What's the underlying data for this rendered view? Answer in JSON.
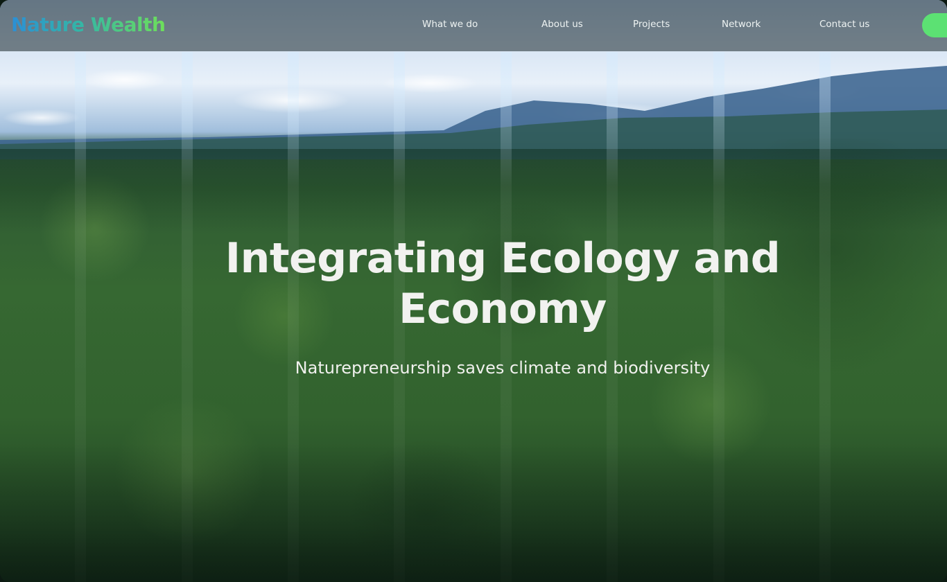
{
  "brand": {
    "name": "Nature Wealth",
    "gradient_from": "#2b8fd6",
    "gradient_to": "#6ee05a"
  },
  "nav": {
    "items": [
      {
        "label": "What we do"
      },
      {
        "label": "About us"
      },
      {
        "label": "Projects"
      },
      {
        "label": "Network"
      },
      {
        "label": "Contact us"
      }
    ],
    "cta_color": "#5ce173"
  },
  "hero": {
    "title": "Integrating Ecology and Economy",
    "subtitle": "Naturepreneurship saves climate and biodiversity",
    "background": "aerial-rainforest-image"
  },
  "colors": {
    "header_bg": "#46555c",
    "text": "#f2f2f0"
  }
}
